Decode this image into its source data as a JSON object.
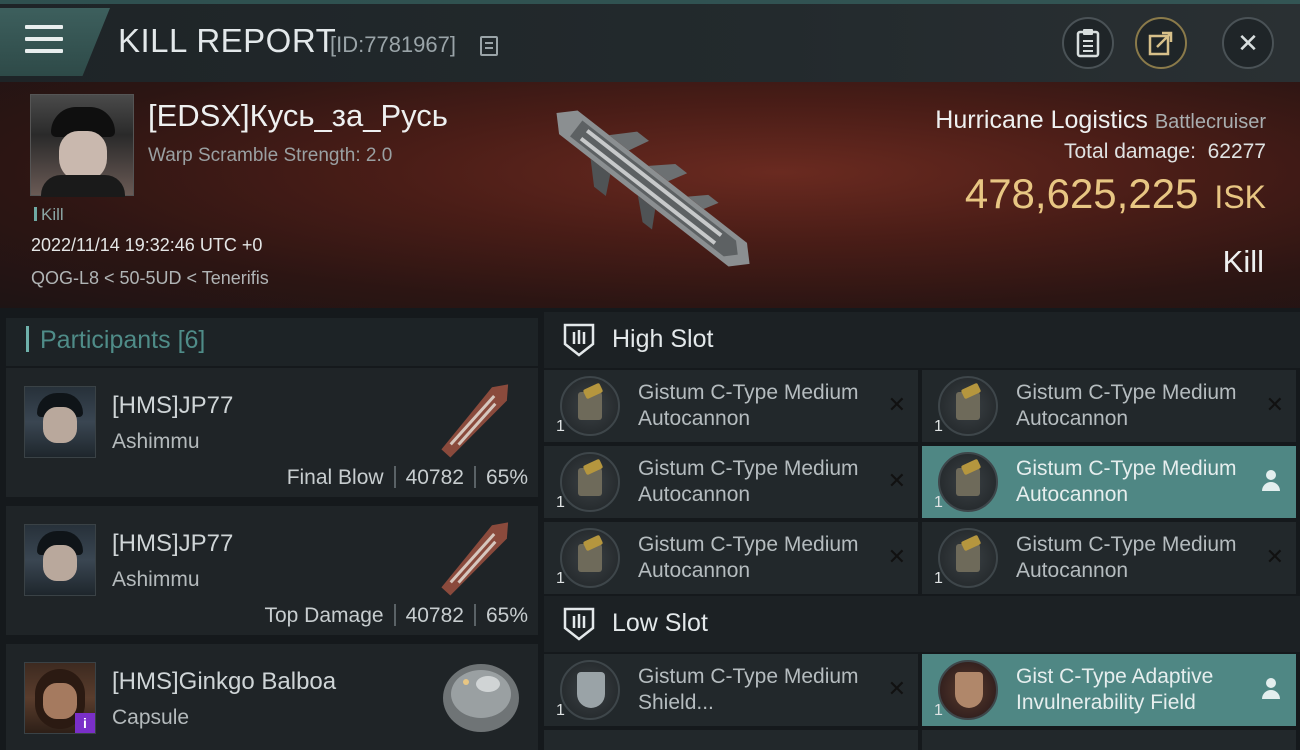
{
  "header": {
    "title": "KILL REPORT",
    "report_id": "[ID:7781967]"
  },
  "victim": {
    "name": "[EDSX]Кусь_за_Русь",
    "scramble": "Warp Scramble Strength: 2.0",
    "tag": "Kill",
    "timestamp": "2022/11/14 19:32:46 UTC +0",
    "location": "QOG-L8 < 50-5UD < Tenerifis",
    "ship_name": "Hurricane Logistics",
    "ship_class": "Battlecruiser",
    "total_damage_label": "Total damage:",
    "total_damage": "62277",
    "isk_value": "478,625,225",
    "isk_unit": "ISK",
    "outcome": "Kill"
  },
  "participants": {
    "label": "Participants",
    "count": "[6]",
    "items": [
      {
        "name": "[HMS]JP77",
        "ship": "Ashimmu",
        "role": "Final Blow",
        "damage": "40782",
        "percent": "65%"
      },
      {
        "name": "[HMS]JP77",
        "ship": "Ashimmu",
        "role": "Top Damage",
        "damage": "40782",
        "percent": "65%"
      },
      {
        "name": "[HMS]Ginkgo Balboa",
        "ship": "Capsule",
        "badge": "i"
      }
    ]
  },
  "slots": {
    "high": {
      "label": "High Slot",
      "modules": [
        {
          "name": "Gistum C-Type Medium Autocannon",
          "qty": "1"
        },
        {
          "name": "Gistum C-Type Medium Autocannon",
          "qty": "1"
        },
        {
          "name": "Gistum C-Type Medium Autocannon",
          "qty": "1"
        },
        {
          "name": "Gistum C-Type Medium Autocannon",
          "qty": "1"
        },
        {
          "name": "Gistum C-Type Medium Autocannon",
          "qty": "1"
        },
        {
          "name": "Gistum C-Type Medium Autocannon",
          "qty": "1"
        }
      ]
    },
    "low": {
      "label": "Low Slot",
      "modules": [
        {
          "name": "Gistum C-Type Medium Shield...",
          "qty": "1"
        },
        {
          "name": "Gist C-Type Adaptive Invulnerability Field",
          "qty": "1"
        }
      ]
    }
  },
  "icons": {
    "close": "✕",
    "destroyed": "✕"
  }
}
